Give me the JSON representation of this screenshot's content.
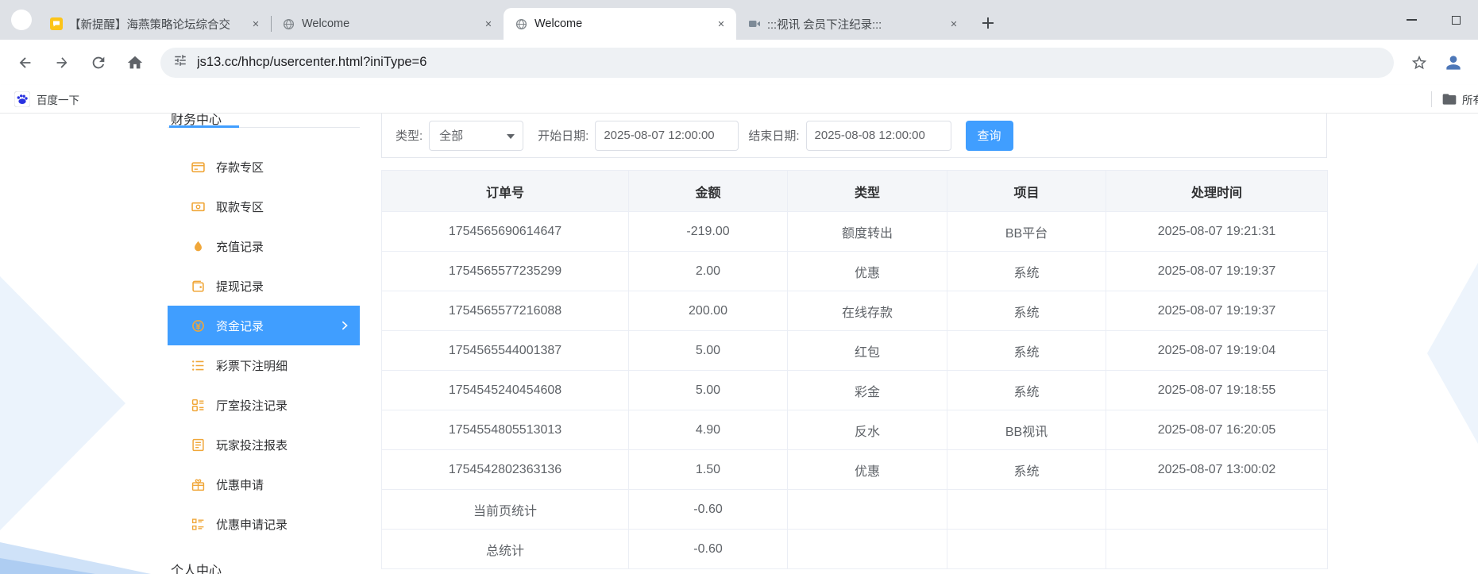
{
  "browser": {
    "tabs": [
      {
        "title": "【新提醒】海燕策略论坛综合交",
        "icon": "forum",
        "active": false
      },
      {
        "title": "Welcome",
        "icon": "globe",
        "active": false
      },
      {
        "title": "Welcome",
        "icon": "globe",
        "active": true
      },
      {
        "title": ":::视讯 会员下注纪录:::",
        "icon": "video",
        "active": false
      }
    ],
    "url": "js13.cc/hhcp/usercenter.html?iniType=6",
    "bookmark_label": "百度一下",
    "all_bookmarks_label": "所有书签"
  },
  "sidebar": {
    "section_top": "财务中心",
    "items": [
      {
        "label": "存款专区",
        "icon": "deposit-icon",
        "active": false
      },
      {
        "label": "取款专区",
        "icon": "withdraw-icon",
        "active": false
      },
      {
        "label": "充值记录",
        "icon": "recharge-icon",
        "active": false
      },
      {
        "label": "提现记录",
        "icon": "withdraw-record-icon",
        "active": false
      },
      {
        "label": "资金记录",
        "icon": "funds-icon",
        "active": true
      },
      {
        "label": "彩票下注明细",
        "icon": "lottery-detail-icon",
        "active": false
      },
      {
        "label": "厅室投注记录",
        "icon": "hall-bet-icon",
        "active": false
      },
      {
        "label": "玩家投注报表",
        "icon": "player-report-icon",
        "active": false
      },
      {
        "label": "优惠申请",
        "icon": "promo-apply-icon",
        "active": false
      },
      {
        "label": "优惠申请记录",
        "icon": "promo-record-icon",
        "active": false
      }
    ],
    "section_bottom": "个人中心"
  },
  "filter": {
    "type_label": "类型:",
    "type_value": "全部",
    "start_label": "开始日期:",
    "start_value": "2025-08-07 12:00:00",
    "end_label": "结束日期:",
    "end_value": "2025-08-08 12:00:00",
    "search_button": "查询"
  },
  "table": {
    "headers": [
      "订单号",
      "金额",
      "类型",
      "项目",
      "处理时间"
    ],
    "rows": [
      [
        "1754565690614647",
        "-219.00",
        "额度转出",
        "BB平台",
        "2025-08-07 19:21:31"
      ],
      [
        "1754565577235299",
        "2.00",
        "优惠",
        "系统",
        "2025-08-07 19:19:37"
      ],
      [
        "1754565577216088",
        "200.00",
        "在线存款",
        "系统",
        "2025-08-07 19:19:37"
      ],
      [
        "1754565544001387",
        "5.00",
        "红包",
        "系统",
        "2025-08-07 19:19:04"
      ],
      [
        "1754545240454608",
        "5.00",
        "彩金",
        "系统",
        "2025-08-07 19:18:55"
      ],
      [
        "1754554805513013",
        "4.90",
        "反水",
        "BB视讯",
        "2025-08-07 16:20:05"
      ],
      [
        "1754542802363136",
        "1.50",
        "优惠",
        "系统",
        "2025-08-07 13:00:02"
      ],
      [
        "当前页统计",
        "-0.60",
        "",
        "",
        ""
      ],
      [
        "总统计",
        "-0.60",
        "",
        "",
        ""
      ]
    ]
  },
  "colors": {
    "accent_blue": "#409eff",
    "sidebar_icon_gold": "#f0a73a",
    "tabbar_bg": "#dee1e6",
    "table_border": "#ebeef5"
  }
}
